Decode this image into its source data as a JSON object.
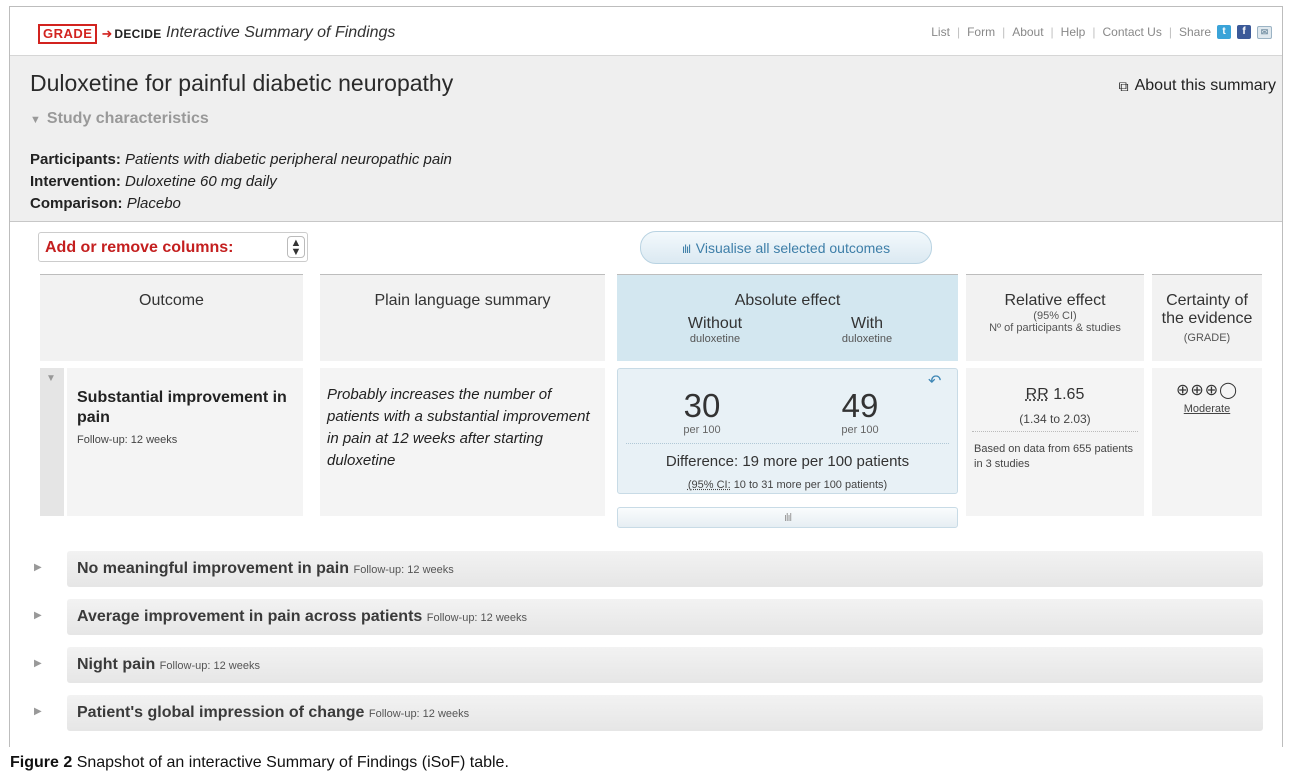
{
  "app": {
    "logo_grade": "GRADE",
    "logo_decide": "DECIDE",
    "title": "Interactive Summary of Findings"
  },
  "nav": {
    "links": [
      "List",
      "Form",
      "About",
      "Help",
      "Contact Us",
      "Share"
    ],
    "share_icons": [
      "twitter-icon",
      "facebook-icon",
      "email-icon"
    ]
  },
  "summary": {
    "title": "Duloxetine for painful diabetic neuropathy",
    "about_label": "About this summary",
    "study_characteristics_label": "Study characteristics",
    "participants_label": "Participants:",
    "participants_value": "Patients with diabetic peripheral neuropathic pain",
    "intervention_label": "Intervention:",
    "intervention_value": "Duloxetine 60 mg daily",
    "comparison_label": "Comparison:",
    "comparison_value": "Placebo"
  },
  "controls": {
    "columns_select": "Add or remove columns:",
    "visualise_button": "Visualise all selected outcomes"
  },
  "columns": {
    "outcome": "Outcome",
    "plain_language": "Plain language summary",
    "absolute_effect": "Absolute effect",
    "without": "Without",
    "without_sub": "duloxetine",
    "with": "With",
    "with_sub": "duloxetine",
    "relative_effect": "Relative effect",
    "relative_ci": "(95% CI)",
    "relative_sub": "Nº of participants & studies",
    "certainty_line1": "Certainty of",
    "certainty_line2": "the evidence",
    "certainty_sub": "(GRADE)"
  },
  "expanded_outcome": {
    "name": "Substantial improvement in pain",
    "follow_up": "Follow-up: 12 weeks",
    "plain_language": "Probably increases the number of patients with a substantial improvement in pain at 12 weeks after starting duloxetine",
    "without_value": "30",
    "without_unit": "per 100",
    "with_value": "49",
    "with_unit": "per 100",
    "difference": "Difference: 19 more per 100 patients",
    "ci_label": "(95% CI:",
    "ci_rest": "10 to 31 more per 100 patients)",
    "rr_label": "RR",
    "rr_value": "1.65",
    "rr_ci": "(1.34 to 2.03)",
    "based_on": "Based on data from 655 patients in 3 studies",
    "certainty_symbols": "⊕⊕⊕◯",
    "certainty_label": "Moderate"
  },
  "collapsed_outcomes": [
    {
      "name": "No meaningful improvement in pain",
      "follow_up": "Follow-up: 12 weeks"
    },
    {
      "name": "Average improvement in pain across patients",
      "follow_up": "Follow-up: 12 weeks"
    },
    {
      "name": "Night pain",
      "follow_up": "Follow-up: 12 weeks"
    },
    {
      "name": "Patient's global impression of change",
      "follow_up": "Follow-up: 12 weeks"
    }
  ],
  "caption": {
    "label": "Figure 2",
    "text": "Snapshot of an interactive Summary of Findings (iSoF) table."
  },
  "colors": {
    "brand_red": "#d2231f",
    "absolute_bg": "#d3e7f0",
    "link_blue": "#3d7ea8"
  }
}
